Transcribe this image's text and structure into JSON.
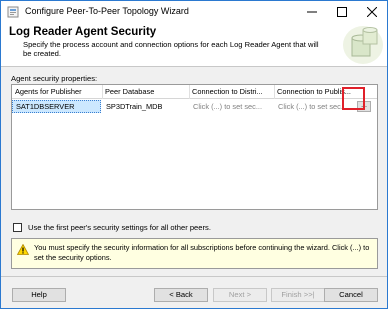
{
  "window": {
    "title": "Configure Peer-To-Peer Topology Wizard"
  },
  "header": {
    "title": "Log Reader Agent Security",
    "description": "Specify the process account and connection options for each Log Reader Agent that will be created."
  },
  "agent_security": {
    "label": "Agent security properties:",
    "columns": [
      "Agents for Publisher",
      "Peer Database",
      "Connection to Distri...",
      "Connection to Publis..."
    ],
    "rows": [
      {
        "agent": "SAT1DBSERVER",
        "database": "SP3DTrain_MDB",
        "distributor": "Click (...) to set sec...",
        "publisher": "Click (...) to set sec...",
        "ellipsis": "..."
      }
    ]
  },
  "checkbox": {
    "label": "Use the first peer's security settings for all other peers.",
    "checked": false
  },
  "warning": {
    "text": "You must specify the security information for all subscriptions before continuing the wizard. Click (...) to set the security options."
  },
  "buttons": {
    "help": "Help",
    "back": "< Back",
    "next": "Next >",
    "finish": "Finish >>|",
    "cancel": "Cancel"
  },
  "colors": {
    "highlight": "#e0202a",
    "selection": "#cce8ff",
    "warning_bg": "#ffffe1"
  },
  "icons": [
    "wizard-app-icon",
    "minimize-icon",
    "maximize-icon",
    "close-icon",
    "database-art-icon",
    "warning-icon"
  ]
}
